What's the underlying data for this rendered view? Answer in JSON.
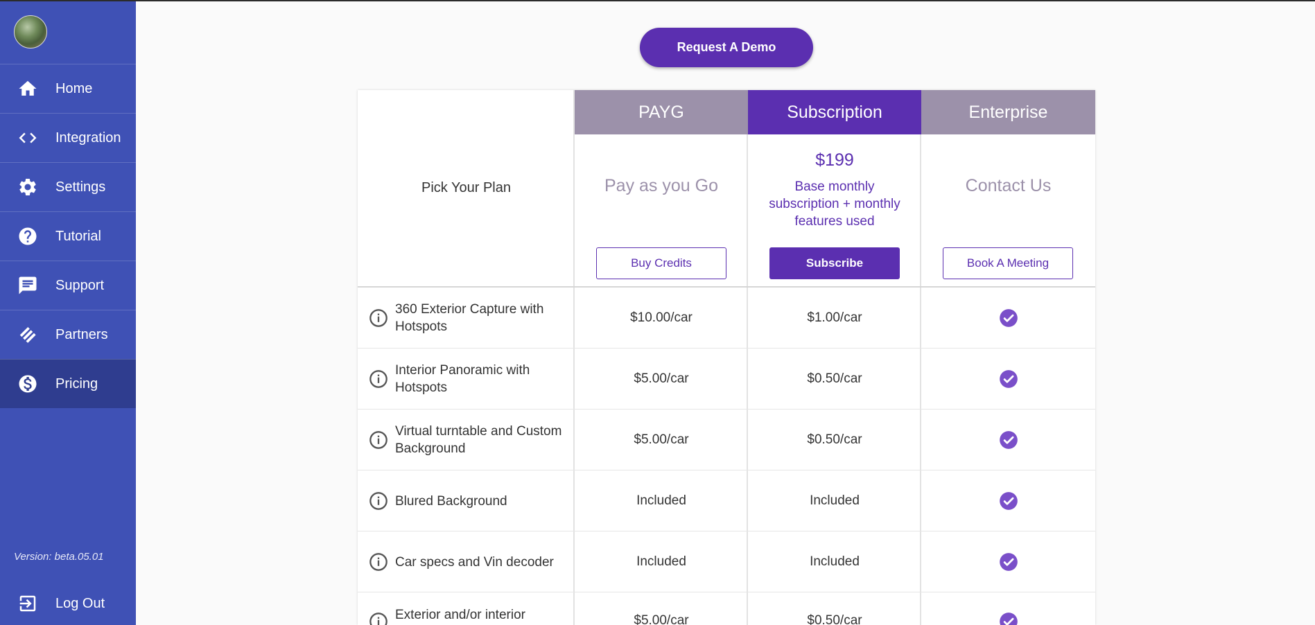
{
  "sidebar": {
    "items": [
      {
        "label": "Home",
        "icon": "home-icon"
      },
      {
        "label": "Integration",
        "icon": "code-icon"
      },
      {
        "label": "Settings",
        "icon": "gear-icon"
      },
      {
        "label": "Tutorial",
        "icon": "help-icon"
      },
      {
        "label": "Support",
        "icon": "chat-icon"
      },
      {
        "label": "Partners",
        "icon": "handshake-icon"
      },
      {
        "label": "Pricing",
        "icon": "dollar-icon"
      }
    ],
    "active": "Pricing",
    "version": "Version: beta.05.01",
    "logout_label": "Log Out",
    "colors": {
      "background": "#3f51b5",
      "active": "#2f3d8f"
    }
  },
  "main": {
    "demo_button_label": "Request A Demo",
    "pick_label": "Pick Your Plan",
    "plans": [
      {
        "name": "PAYG",
        "description": "Pay as you Go",
        "button": "Buy Credits"
      },
      {
        "name": "Subscription",
        "price": "$199",
        "description": "Base monthly subscription + monthly features used",
        "button": "Subscribe"
      },
      {
        "name": "Enterprise",
        "description": "Contact Us",
        "button": "Book A Meeting"
      }
    ],
    "features": [
      {
        "label": "360 Exterior Capture with Hotspots",
        "payg": "$10.00/car",
        "subscription": "$1.00/car",
        "enterprise": "check-icon"
      },
      {
        "label": "Interior Panoramic with Hotspots",
        "payg": "$5.00/car",
        "subscription": "$0.50/car",
        "enterprise": "check-icon"
      },
      {
        "label": "Virtual turntable and Custom Background",
        "payg": "$5.00/car",
        "subscription": "$0.50/car",
        "enterprise": "check-icon"
      },
      {
        "label": "Blured Background",
        "payg": "Included",
        "subscription": "Included",
        "enterprise": "check-icon"
      },
      {
        "label": "Car specs and Vin decoder",
        "payg": "Included",
        "subscription": "Included",
        "enterprise": "check-icon"
      },
      {
        "label": "Exterior and/or interior",
        "payg": "$5.00/car",
        "subscription": "$0.50/car",
        "enterprise": "check-icon"
      }
    ],
    "colors": {
      "accent": "#5b2fb0",
      "muted": "#9c91aa",
      "check": "#7a4fc9"
    }
  }
}
